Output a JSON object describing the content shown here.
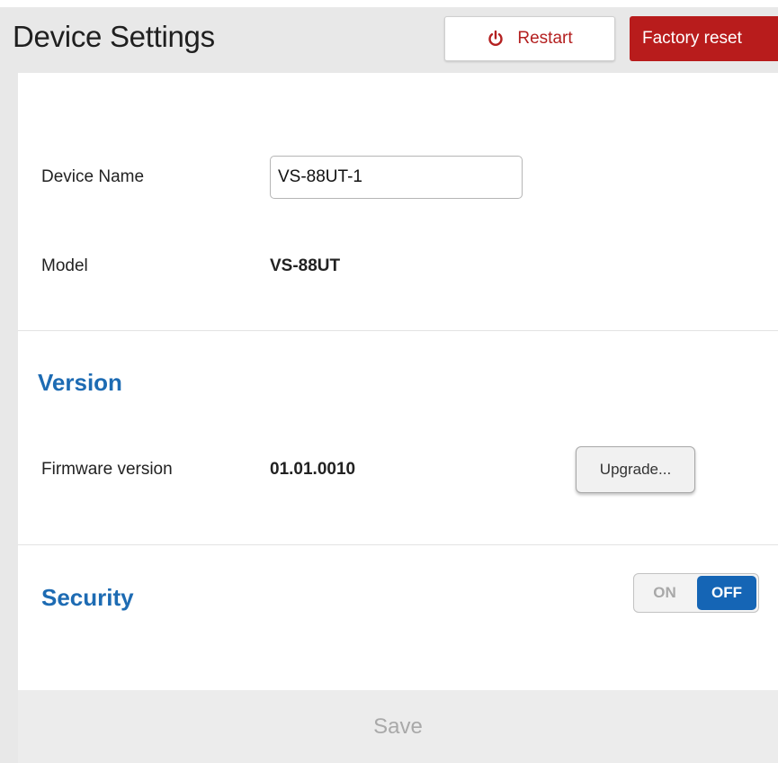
{
  "header": {
    "title": "Device Settings",
    "restart_label": "Restart",
    "factory_reset_label": "Factory reset"
  },
  "device": {
    "name_label": "Device Name",
    "name_value": "VS-88UT-1",
    "model_label": "Model",
    "model_value": "VS-88UT"
  },
  "version": {
    "title": "Version",
    "firmware_label": "Firmware version",
    "firmware_value": "01.01.0010",
    "upgrade_label": "Upgrade..."
  },
  "security": {
    "title": "Security",
    "toggle_on_label": "ON",
    "toggle_off_label": "OFF",
    "state": "OFF"
  },
  "footer": {
    "save_label": "Save"
  },
  "colors": {
    "accent_blue": "#1d6bb3",
    "danger_red": "#b81c1c",
    "toggle_active": "#1565b5"
  },
  "icons": {
    "restart": "power-icon"
  }
}
